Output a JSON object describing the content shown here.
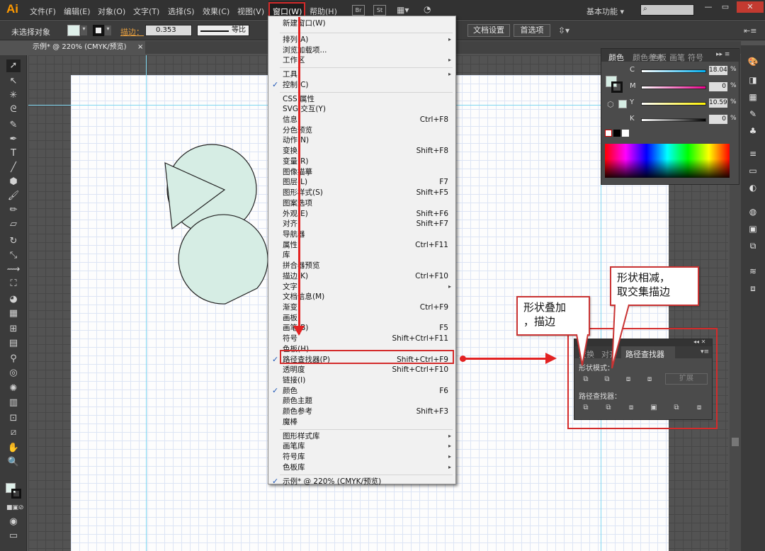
{
  "app": {
    "logo": "Ai"
  },
  "menubar": {
    "items": [
      "文件(F)",
      "编辑(E)",
      "对象(O)",
      "文字(T)",
      "选择(S)",
      "效果(C)",
      "视图(V)",
      "窗口(W)",
      "帮助(H)"
    ],
    "bridge_btn": "Br",
    "stock_btn": "St",
    "workspace": "基本功能",
    "workspace_arrow": "▾"
  },
  "window_controls": {
    "minimize": "—",
    "restore": "▭",
    "close": "✕"
  },
  "controlbar": {
    "selection": "未选择对象",
    "stroke_label": "描边：",
    "stroke_value": "0.353",
    "stroke_profile": "等比",
    "doc_setup": "文档设置",
    "preferences": "首选项"
  },
  "document": {
    "tab": "示例* @ 220% (CMYK/预览)",
    "tab_close": "×"
  },
  "window_menu": {
    "items": [
      {
        "label": "新建窗口(W)"
      },
      {
        "sep": true
      },
      {
        "label": "排列(A)",
        "submenu": true
      },
      {
        "label": "浏览加载项..."
      },
      {
        "label": "工作区",
        "submenu": true
      },
      {
        "sep": true
      },
      {
        "label": "工具",
        "submenu": true
      },
      {
        "label": "控制(C)",
        "checked": true
      },
      {
        "sep": true
      },
      {
        "label": "CSS 属性"
      },
      {
        "label": "SVG 交互(Y)"
      },
      {
        "label": "信息",
        "shortcut": "Ctrl+F8"
      },
      {
        "label": "分色预览"
      },
      {
        "label": "动作(N)"
      },
      {
        "label": "变换",
        "shortcut": "Shift+F8"
      },
      {
        "label": "变量(R)"
      },
      {
        "label": "图像描摹"
      },
      {
        "label": "图层(L)",
        "shortcut": "F7"
      },
      {
        "label": "图形样式(S)",
        "shortcut": "Shift+F5"
      },
      {
        "label": "图案选项"
      },
      {
        "label": "外观(E)",
        "shortcut": "Shift+F6"
      },
      {
        "label": "对齐",
        "shortcut": "Shift+F7"
      },
      {
        "label": "导航器"
      },
      {
        "label": "属性",
        "shortcut": "Ctrl+F11"
      },
      {
        "label": "库"
      },
      {
        "label": "拼合器预览"
      },
      {
        "label": "描边(K)",
        "shortcut": "Ctrl+F10"
      },
      {
        "label": "文字",
        "submenu": true
      },
      {
        "label": "文档信息(M)"
      },
      {
        "label": "渐变",
        "shortcut": "Ctrl+F9"
      },
      {
        "label": "画板"
      },
      {
        "label": "画笔(B)",
        "shortcut": "F5"
      },
      {
        "label": "符号",
        "shortcut": "Shift+Ctrl+F11"
      },
      {
        "label": "色板(H)"
      },
      {
        "label": "路径查找器(P)",
        "shortcut": "Shift+Ctrl+F9",
        "checked": true,
        "highlight": true
      },
      {
        "label": "透明度",
        "shortcut": "Shift+Ctrl+F10"
      },
      {
        "label": "链接(I)"
      },
      {
        "label": "颜色",
        "shortcut": "F6",
        "checked": true
      },
      {
        "label": "颜色主题"
      },
      {
        "label": "颜色参考",
        "shortcut": "Shift+F3"
      },
      {
        "label": "魔棒"
      },
      {
        "sep": true
      },
      {
        "label": "图形样式库",
        "submenu": true
      },
      {
        "label": "画笔库",
        "submenu": true
      },
      {
        "label": "符号库",
        "submenu": true
      },
      {
        "label": "色板库",
        "submenu": true
      },
      {
        "sep": true
      },
      {
        "label": "示例* @ 220% (CMYK/预览)",
        "checked": true
      }
    ]
  },
  "color_panel": {
    "tabs": [
      "颜色",
      "颜色参考",
      "色板",
      "画笔",
      "符号"
    ],
    "channels": [
      {
        "name": "C",
        "value": "18.04",
        "unit": "%"
      },
      {
        "name": "M",
        "value": "0",
        "unit": "%"
      },
      {
        "name": "Y",
        "value": "10.59",
        "unit": "%"
      },
      {
        "name": "K",
        "value": "0",
        "unit": "%"
      }
    ],
    "fill_color": "#d6ede4"
  },
  "pathfinder_panel": {
    "tabs": [
      "变换",
      "对齐",
      "路径查找器"
    ],
    "shape_modes_label": "形状模式：",
    "expand_label": "扩展",
    "pathfinders_label": "路径查找器："
  },
  "callouts": {
    "add_stroke": [
      "形状叠加",
      "，描边"
    ],
    "subtract_intersect": [
      "形状相减，",
      "取交集描边"
    ]
  },
  "colors": {
    "shape_fill": "#d6ede4",
    "annotation_red": "#e32222",
    "app_orange": "#ff9a00"
  }
}
